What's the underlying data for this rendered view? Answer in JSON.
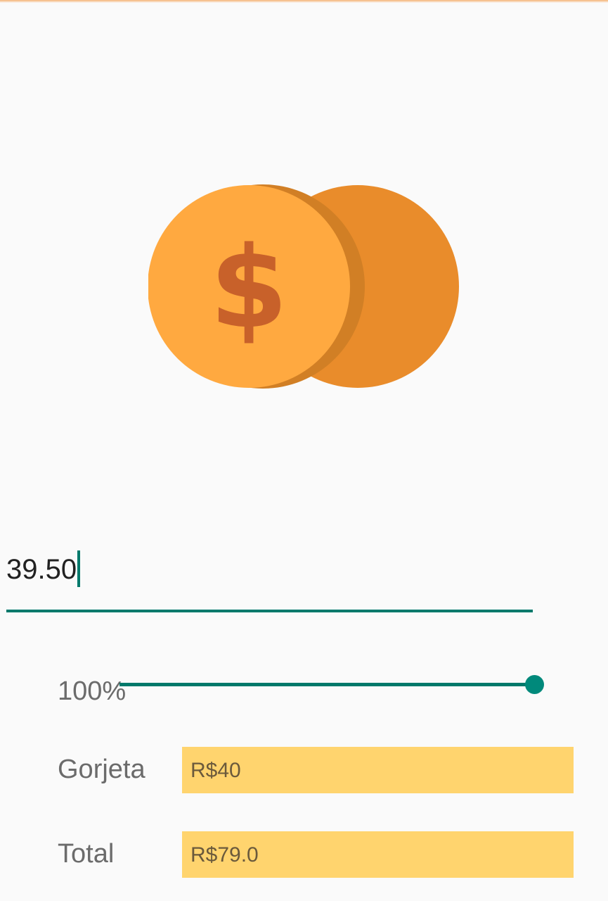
{
  "colors": {
    "accent": "#00796b",
    "coin_front": "#ffa940",
    "coin_back": "#e98c2b",
    "dollar_sign": "#c8612a",
    "result_box": "#ffd46e"
  },
  "logo": {
    "icon": "coins-dollar-icon"
  },
  "bill_input": {
    "value": "39.50"
  },
  "tip_slider": {
    "label": "100%",
    "value_percent": 100,
    "min": 0,
    "max": 100
  },
  "results": {
    "tip": {
      "label": "Gorjeta",
      "value": "R$40"
    },
    "total": {
      "label": "Total",
      "value": "R$79.0"
    }
  }
}
